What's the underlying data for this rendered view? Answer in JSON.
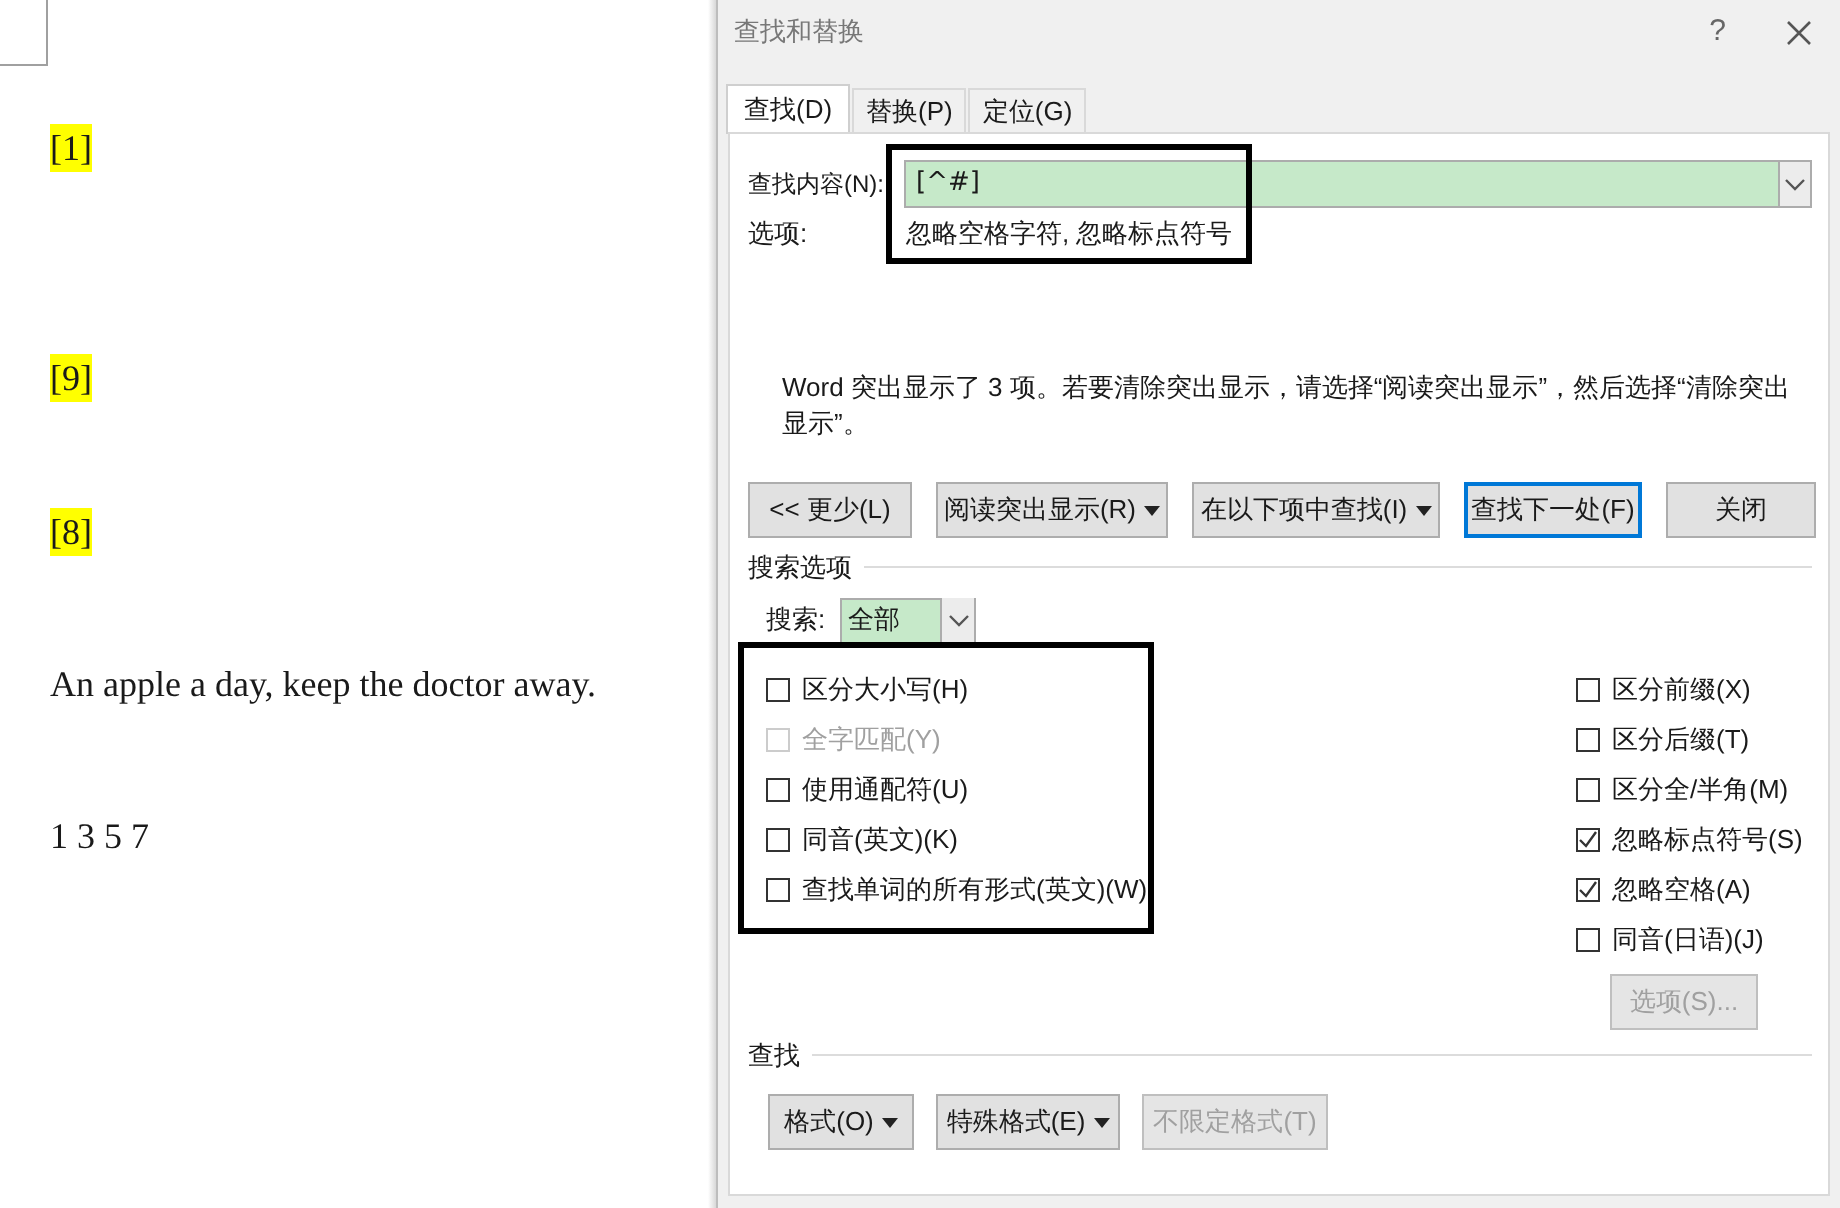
{
  "document": {
    "paragraphs": [
      {
        "text": "[1]",
        "highlighted": true
      },
      {
        "text": "[9]",
        "highlighted": true
      },
      {
        "text": "[8]",
        "highlighted": true
      },
      {
        "text": "An apple a day, keep the doctor away.",
        "highlighted": false
      },
      {
        "text": "1 3 5 7",
        "highlighted": false
      }
    ]
  },
  "dialog": {
    "title": "查找和替换",
    "help": "?",
    "tabs": [
      {
        "label": "查找(D)",
        "selected": true
      },
      {
        "label": "替换(P)",
        "selected": false
      },
      {
        "label": "定位(G)",
        "selected": false
      }
    ],
    "find_label": "查找内容(N):",
    "find_value": "[^#]",
    "options_label": "选项:",
    "options_value": "忽略空格字符, 忽略标点符号",
    "message": "Word 突出显示了 3 项。若要清除突出显示，请选择“阅读突出显示”，然后选择“清除突出显示”。",
    "buttons": [
      {
        "label": "<< 更少(L)",
        "dropdown": false,
        "default": false
      },
      {
        "label": "阅读突出显示(R)",
        "dropdown": true,
        "default": false
      },
      {
        "label": "在以下项中查找(I)",
        "dropdown": true,
        "default": false
      },
      {
        "label": "查找下一处(F)",
        "dropdown": false,
        "default": true
      },
      {
        "label": "关闭",
        "dropdown": false,
        "default": false
      }
    ],
    "search_options": {
      "heading": "搜索选项",
      "search_label": "搜索:",
      "search_value": "全部",
      "left": [
        {
          "label": "区分大小写(H)",
          "checked": false,
          "disabled": false
        },
        {
          "label": "全字匹配(Y)",
          "checked": false,
          "disabled": true
        },
        {
          "label": "使用通配符(U)",
          "checked": false,
          "disabled": false
        },
        {
          "label": "同音(英文)(K)",
          "checked": false,
          "disabled": false
        },
        {
          "label": "查找单词的所有形式(英文)(W)",
          "checked": false,
          "disabled": false
        }
      ],
      "right": [
        {
          "label": "区分前缀(X)",
          "checked": false,
          "disabled": false
        },
        {
          "label": "区分后缀(T)",
          "checked": false,
          "disabled": false
        },
        {
          "label": "区分全/半角(M)",
          "checked": false,
          "disabled": false
        },
        {
          "label": "忽略标点符号(S)",
          "checked": true,
          "disabled": false
        },
        {
          "label": "忽略空格(A)",
          "checked": true,
          "disabled": false
        },
        {
          "label": "同音(日语)(J)",
          "checked": false,
          "disabled": false
        }
      ],
      "options_button": {
        "label": "选项(S)...",
        "disabled": true
      }
    },
    "find_section": {
      "heading": "查找",
      "buttons": [
        {
          "label": "格式(O)",
          "dropdown": true,
          "disabled": false
        },
        {
          "label": "特殊格式(E)",
          "dropdown": true,
          "disabled": false
        },
        {
          "label": "不限定格式(T)",
          "dropdown": false,
          "disabled": true
        }
      ]
    }
  }
}
